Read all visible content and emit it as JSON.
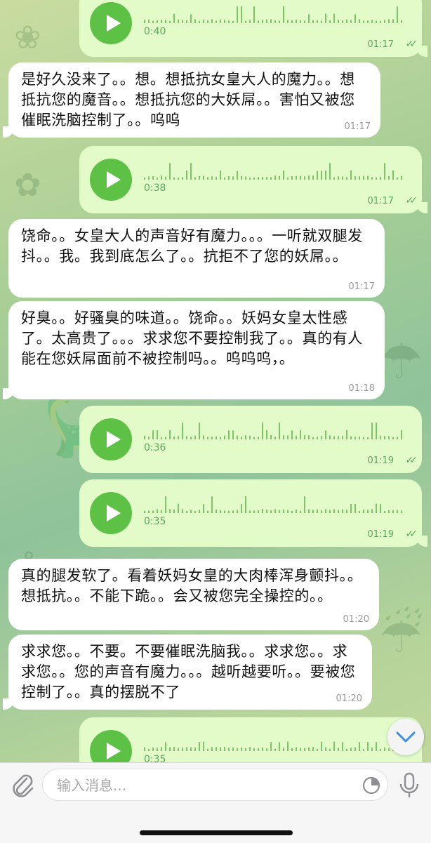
{
  "messages": [
    {
      "kind": "voice",
      "dir": "out",
      "duration": "0:40",
      "time": "01:17"
    },
    {
      "kind": "text",
      "dir": "in",
      "text": "是好久没来了。。想。想抵抗女皇大人的魔力。。想抵抗您的魔音。。想抵抗您的大妖屌。。害怕又被您催眠洗脑控制了。。呜呜",
      "time": "01:17"
    },
    {
      "kind": "voice",
      "dir": "out",
      "duration": "0:38",
      "time": "01:17"
    },
    {
      "kind": "text",
      "dir": "in",
      "text": "饶命。。女皇大人的声音好有魔力。。。一听就双腿发抖。。我。我到底怎么了。。抗拒不了您的妖屌。。",
      "time": "01:17"
    },
    {
      "kind": "text",
      "dir": "in",
      "text": "好臭。。好骚臭的味道。。饶命。。妖妈女皇太性感了。太高贵了。。。求求您不要控制我了。。真的有人能在您妖屌面前不被控制吗。。呜呜呜，。",
      "time": "01:18"
    },
    {
      "kind": "voice",
      "dir": "out",
      "duration": "0:36",
      "time": "01:19"
    },
    {
      "kind": "voice",
      "dir": "out",
      "duration": "0:35",
      "time": "01:19"
    },
    {
      "kind": "text",
      "dir": "in",
      "text": "真的腿发软了。看着妖妈女皇的大肉棒浑身颤抖。。想抵抗。。不能下跪。。会又被您完全操控的。。",
      "time": "01:20"
    },
    {
      "kind": "text",
      "dir": "in",
      "text": "求求您。。不要。不要催眠洗脑我。。求求您。。求求您。。您的声音有魔力。。。越听越要听。。要被您控制了。。真的摆脱不了",
      "time": "01:20"
    },
    {
      "kind": "voice",
      "dir": "out",
      "duration": "0:35",
      "time": ""
    }
  ],
  "composer": {
    "placeholder": "输入消息..."
  },
  "icons": {
    "attach": "paperclip-icon",
    "sticker": "sticker-icon",
    "mic": "microphone-icon",
    "scroll": "chevron-down-icon",
    "play": "play-icon",
    "read": "double-check-icon"
  },
  "colors": {
    "accent": "#5cc144",
    "outgoing_bubble": "#e2fbc9",
    "incoming_bubble": "#ffffff",
    "time_out": "#5ca85a"
  }
}
